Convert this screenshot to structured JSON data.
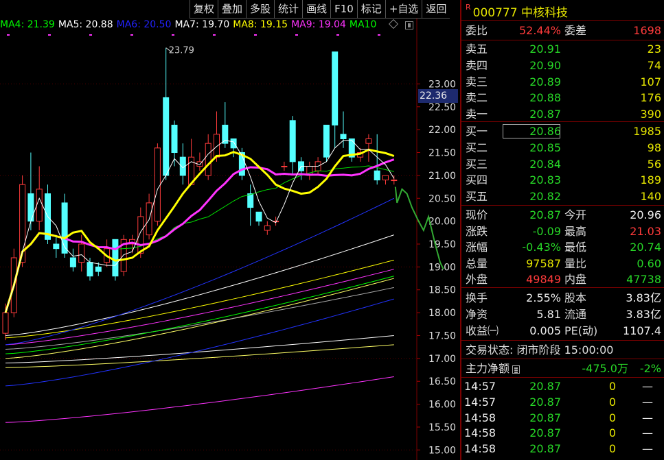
{
  "toolbar": [
    "复权",
    "叠加",
    "多股",
    "统计",
    "画线",
    "F10",
    "标记",
    "+自选",
    "返回"
  ],
  "ma_legend": [
    {
      "label": "MA4: 21.39",
      "color": "#00ff00"
    },
    {
      "label": "MA5: 20.88",
      "color": "#ffffff"
    },
    {
      "label": "MA6: 20.50",
      "color": "#2222ff"
    },
    {
      "label": "MA7: 19.70",
      "color": "#ffffff"
    },
    {
      "label": "MA8: 19.15",
      "color": "#ffff00"
    },
    {
      "label": "MA9: 19.04",
      "color": "#ff33ff"
    },
    {
      "label": "MA10",
      "color": "#00ff00"
    }
  ],
  "chart": {
    "y_ticks": [
      "23.00",
      "22.50",
      "22.00",
      "21.50",
      "21.00",
      "20.50",
      "20.00",
      "19.50",
      "19.00",
      "18.50",
      "18.00",
      "17.50",
      "17.00",
      "16.50",
      "16.00",
      "15.50",
      "15.00"
    ],
    "high_label": "23.79",
    "current_price_label": "22.36",
    "ylim": [
      14.9,
      23.95
    ],
    "candles": [
      [
        17.55,
        18.0,
        17.4,
        18.2
      ],
      [
        18.0,
        19.2,
        17.9,
        19.4
      ],
      [
        19.1,
        20.8,
        19.0,
        21.0
      ],
      [
        20.6,
        20.0,
        19.8,
        21.5
      ],
      [
        20.0,
        20.7,
        19.8,
        21.2
      ],
      [
        20.6,
        19.6,
        19.5,
        20.8
      ],
      [
        19.5,
        19.4,
        19.2,
        19.7
      ],
      [
        20.4,
        19.3,
        19.2,
        20.6
      ],
      [
        19.2,
        19.0,
        18.9,
        19.4
      ],
      [
        19.1,
        19.5,
        18.9,
        19.7
      ],
      [
        19.1,
        18.8,
        18.7,
        19.2
      ],
      [
        19.0,
        18.9,
        18.8,
        19.1
      ],
      [
        19.1,
        19.4,
        19.0,
        19.6
      ],
      [
        19.6,
        18.8,
        18.7,
        19.6
      ],
      [
        18.9,
        19.6,
        18.8,
        19.7
      ],
      [
        19.5,
        19.6,
        19.3,
        19.7
      ],
      [
        19.3,
        20.1,
        19.2,
        20.3
      ],
      [
        19.7,
        20.4,
        19.6,
        20.6
      ],
      [
        20.0,
        21.6,
        19.9,
        21.7
      ],
      [
        22.7,
        21.0,
        20.9,
        23.79
      ],
      [
        22.1,
        21.5,
        21.2,
        22.2
      ],
      [
        21.4,
        21.0,
        20.8,
        21.7
      ],
      [
        20.8,
        21.4,
        20.8,
        21.8
      ],
      [
        21.2,
        21.3,
        21.1,
        21.5
      ],
      [
        21.0,
        21.7,
        20.9,
        21.9
      ],
      [
        21.4,
        21.9,
        21.3,
        22.4
      ],
      [
        22.1,
        21.7,
        21.6,
        22.6
      ],
      [
        21.8,
        21.6,
        21.4,
        21.8
      ],
      [
        21.5,
        21.0,
        20.9,
        21.6
      ],
      [
        20.6,
        20.3,
        19.9,
        20.8
      ],
      [
        20.2,
        20.0,
        19.9,
        20.2
      ],
      [
        19.8,
        19.9,
        19.7,
        20.0
      ],
      [
        20.0,
        20.0,
        19.9,
        20.1
      ],
      [
        21.2,
        21.2,
        21.1,
        21.3
      ],
      [
        22.2,
        21.3,
        21.0,
        22.3
      ],
      [
        21.3,
        21.1,
        20.9,
        21.4
      ],
      [
        21.0,
        21.2,
        20.9,
        21.3
      ],
      [
        21.1,
        21.3,
        21.0,
        21.4
      ],
      [
        22.1,
        21.4,
        21.3,
        22.1
      ],
      [
        23.7,
        22.1,
        21.6,
        23.7
      ],
      [
        21.9,
        21.8,
        21.6,
        22.4
      ],
      [
        21.8,
        21.4,
        21.3,
        21.8
      ],
      [
        21.4,
        21.5,
        21.3,
        21.6
      ],
      [
        21.7,
        21.8,
        21.3,
        21.9
      ],
      [
        21.1,
        20.9,
        20.8,
        21.9
      ],
      [
        20.9,
        21.0,
        20.8,
        21.0
      ],
      [
        20.9,
        20.9,
        20.8,
        21.0
      ]
    ],
    "projection": [
      [
        20.9,
        20.75
      ],
      [
        21.0,
        20.4
      ],
      [
        21.3,
        20.7
      ],
      [
        21.6,
        20.6
      ],
      [
        21.9,
        20.3
      ],
      [
        22.3,
        20.0
      ],
      [
        22.6,
        19.8
      ],
      [
        22.9,
        20.1
      ],
      [
        23.3,
        19.5
      ],
      [
        23.6,
        19.1
      ],
      [
        23.8,
        18.95
      ]
    ]
  },
  "quote": {
    "code": "000777",
    "name": "中核科技",
    "weibi_label": "委比",
    "weibi": "52.44%",
    "weicha_label": "委差",
    "weicha": "1698",
    "asks": [
      {
        "label": "卖五",
        "price": "20.91",
        "vol": "23"
      },
      {
        "label": "卖四",
        "price": "20.90",
        "vol": "74"
      },
      {
        "label": "卖三",
        "price": "20.89",
        "vol": "107"
      },
      {
        "label": "卖二",
        "price": "20.88",
        "vol": "176"
      },
      {
        "label": "卖一",
        "price": "20.87",
        "vol": "390"
      }
    ],
    "bids": [
      {
        "label": "买一",
        "price": "20.86",
        "vol": "1985"
      },
      {
        "label": "买二",
        "price": "20.85",
        "vol": "98"
      },
      {
        "label": "买三",
        "price": "20.84",
        "vol": "56"
      },
      {
        "label": "买四",
        "price": "20.83",
        "vol": "189"
      },
      {
        "label": "买五",
        "price": "20.82",
        "vol": "140"
      }
    ],
    "stats": [
      {
        "l1": "现价",
        "v1": "20.87",
        "c1": "green",
        "l2": "今开",
        "v2": "20.96",
        "c2": "white"
      },
      {
        "l1": "涨跌",
        "v1": "-0.09",
        "c1": "green",
        "l2": "最高",
        "v2": "21.03",
        "c2": "red"
      },
      {
        "l1": "涨幅",
        "v1": "-0.43%",
        "c1": "green",
        "l2": "最低",
        "v2": "20.74",
        "c2": "green"
      },
      {
        "l1": "总量",
        "v1": "97587",
        "c1": "yellow",
        "l2": "量比",
        "v2": "0.60",
        "c2": "green"
      },
      {
        "l1": "外盘",
        "v1": "49849",
        "c1": "red",
        "l2": "内盘",
        "v2": "47738",
        "c2": "green"
      }
    ],
    "stats2": [
      {
        "l1": "换手",
        "v1": "2.55%",
        "l2": "股本",
        "v2": "3.83亿"
      },
      {
        "l1": "净资",
        "v1": "5.81",
        "l2": "流通",
        "v2": "3.83亿"
      },
      {
        "l1": "收益㈠",
        "v1": "0.005",
        "l2": "PE(动)",
        "v2": "1107.4"
      }
    ],
    "trade_status": "交易状态: 闭市阶段 15:00:00",
    "main_flow_label": "主力净额",
    "main_flow_value": "-475.0万",
    "main_flow_pct": "-2%",
    "ticks": [
      {
        "time": "14:57",
        "price": "20.87",
        "vol": "0",
        "flag": "—"
      },
      {
        "time": "14:57",
        "price": "20.87",
        "vol": "0",
        "flag": "—"
      },
      {
        "time": "14:58",
        "price": "20.87",
        "vol": "0",
        "flag": "—"
      },
      {
        "time": "14:58",
        "price": "20.87",
        "vol": "0",
        "flag": "—"
      },
      {
        "time": "14:58",
        "price": "20.87",
        "vol": "0",
        "flag": "—"
      }
    ]
  }
}
